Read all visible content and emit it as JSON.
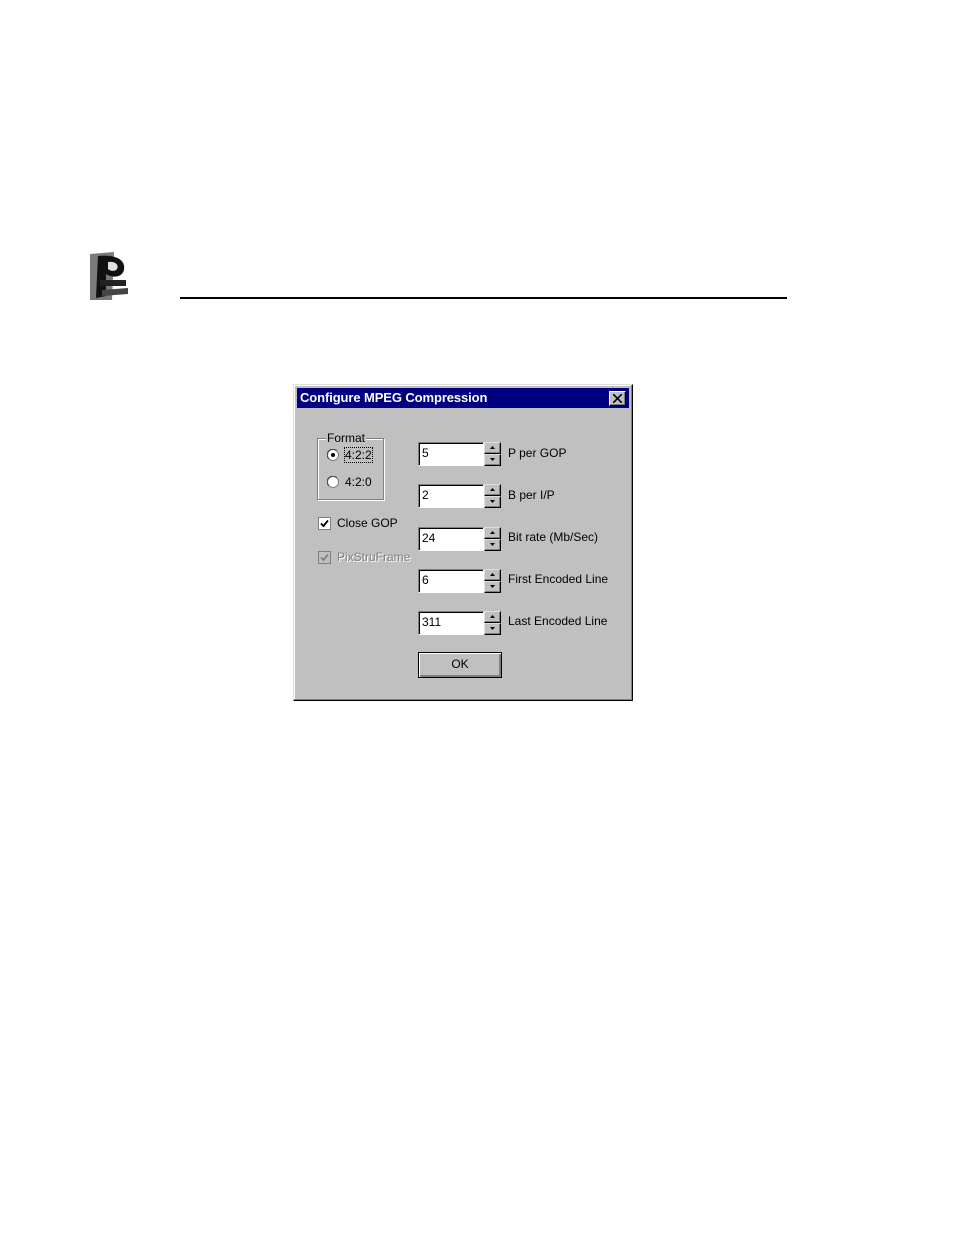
{
  "dialog": {
    "title": "Configure MPEG Compression",
    "format": {
      "label": "Format",
      "options": [
        "4:2:2",
        "4:2:0"
      ],
      "selected": "4:2:2"
    },
    "close_gop": {
      "label": "Close GOP",
      "checked": true
    },
    "pix_stru_frame": {
      "label": "PixStruFrame",
      "checked": true,
      "enabled": false
    },
    "fields": [
      {
        "value": "5",
        "label": "P per GOP"
      },
      {
        "value": "2",
        "label": "B per I/P"
      },
      {
        "value": "24",
        "label": "Bit rate (Mb/Sec)"
      },
      {
        "value": "6",
        "label": "First Encoded Line"
      },
      {
        "value": "311",
        "label": "Last Encoded Line"
      }
    ],
    "ok_label": "OK"
  }
}
